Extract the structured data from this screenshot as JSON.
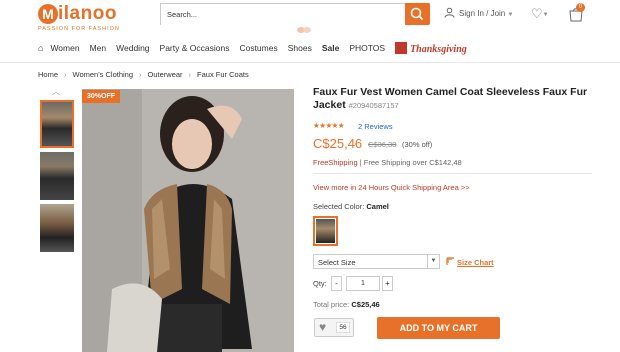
{
  "header": {
    "logo_letter": "M",
    "logo_word": "ilanoo",
    "logo_tagline": "PASSION FOR FASHION",
    "search_placeholder": "Search...",
    "signin_label": "Sign In / Join",
    "cart_count": "0"
  },
  "nav": {
    "items": [
      "Women",
      "Men",
      "Wedding",
      "Party & Occasions",
      "Costumes",
      "Shoes",
      "Sale",
      "PHOTOS",
      "Thanksgiving"
    ]
  },
  "breadcrumb": [
    "Home",
    "Women's Clothing",
    "Outerwear",
    "Faux Fur Coats"
  ],
  "product": {
    "discount_badge": "30%OFF",
    "title": "Faux Fur Vest Women Camel Coat Sleeveless Faux Fur Jacket",
    "sku": "#20940587157",
    "stars": "★★★★★",
    "rating": 5,
    "reviews": "2 Reviews",
    "price": "C$25,46",
    "original_price": "C$36,38",
    "percent_off": "(30% off)",
    "free_shipping": "FreeShipping",
    "shipping_note": "| Free Shipping over C$142,48",
    "quick_ship": "View more in 24 Hours Quick Shipping Area >>",
    "selected_color_label": "Selected Color:",
    "selected_color": "Camel",
    "size_select": "Select Size",
    "size_chart": "Size Chart",
    "qty_label": "Qty:",
    "qty_minus": "-",
    "qty_value": "1",
    "qty_plus": "+",
    "total_label": "Total price:",
    "total_value": "C$25,46",
    "wish_count": "56",
    "add_to_cart": "ADD TO MY CART"
  },
  "colors": {
    "accent": "#e8712a",
    "link": "#2266cc",
    "sale_red": "#c0392b"
  }
}
